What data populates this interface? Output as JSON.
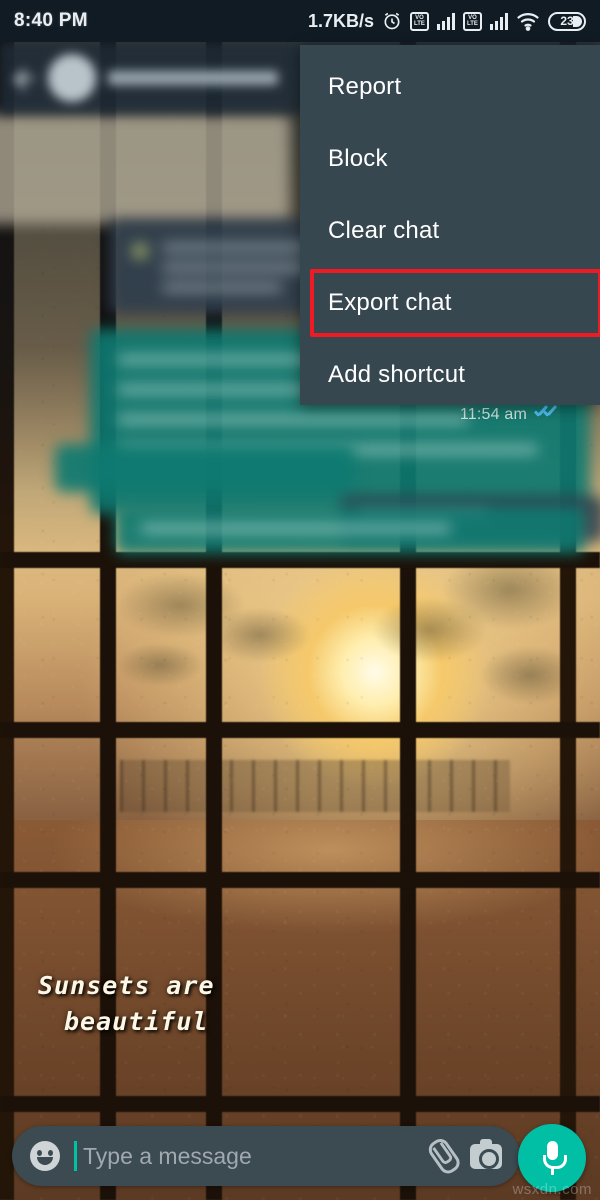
{
  "status_bar": {
    "clock": "8:40 PM",
    "net_speed": "1.7KB/s",
    "alarm_icon": "alarm-clock-icon",
    "volte_label_top": "VO",
    "volte_label_bottom": "LTE",
    "sim1_signal_icon": "signal-bars-icon",
    "sim2_signal_icon": "signal-bars-icon",
    "wifi_icon": "wifi-icon",
    "battery_percent": "23",
    "bg_color": "#111b24",
    "fg_color": "#e9eef2"
  },
  "chat_header": {
    "back_icon": "back-arrow-icon",
    "avatar": "contact-avatar",
    "contact_name": "",
    "blurred": "true"
  },
  "conversation": {
    "timestamp": "11:54 am",
    "read_receipt_icon": "double-blue-check-icon",
    "read_receipt_color": "#4fc3f7",
    "outgoing_bubble_color": "#0e7a71",
    "incoming_bubble_color": "#2f3e4d",
    "bubbles_blurred": "true"
  },
  "menu": {
    "background": "#37474f",
    "highlight_color": "#ee1b24",
    "items": [
      {
        "label": "Report",
        "highlighted": false
      },
      {
        "label": "Block",
        "highlighted": false
      },
      {
        "label": "Clear chat",
        "highlighted": false
      },
      {
        "label": "Export chat",
        "highlighted": true
      },
      {
        "label": "Add shortcut",
        "highlighted": false
      }
    ]
  },
  "wallpaper": {
    "caption_line1": "Sunsets are",
    "caption_line2": "beautiful",
    "scene": "sunset-through-window-grille"
  },
  "input_bar": {
    "emoji_icon": "smiley-face-icon",
    "placeholder": "Type a message",
    "value": "",
    "attach_icon": "paperclip-icon",
    "camera_icon": "camera-icon",
    "mic_icon": "microphone-icon",
    "mic_button_color": "#00bfa5",
    "pill_color": "#3c4a52"
  },
  "watermark": {
    "text": "wsxdn.com"
  }
}
